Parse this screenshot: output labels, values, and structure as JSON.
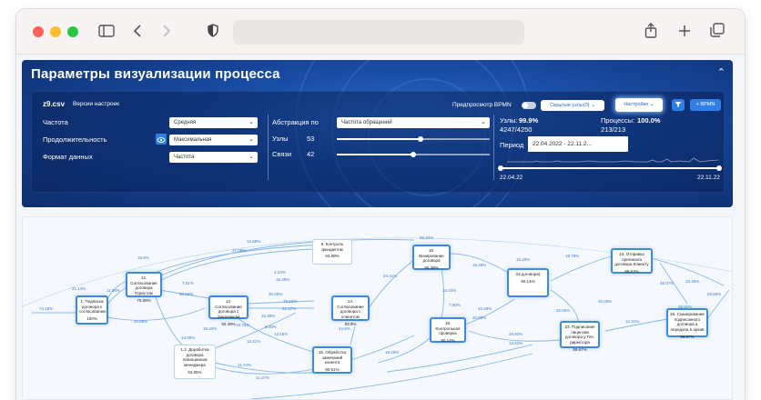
{
  "browser": {
    "icons": {
      "sidebar": "sidebar-icon",
      "back": "chevron-left-icon",
      "forward": "chevron-right-icon",
      "shield": "shield-icon",
      "share": "share-icon",
      "new_tab": "plus-icon",
      "tabs": "tabs-icon"
    }
  },
  "panel": {
    "title": "Параметры визуализации процесса",
    "file_name": "z9.csv",
    "settings_versions": "Версии настроек",
    "params": [
      {
        "label": "Частота",
        "value": "Средняя"
      },
      {
        "label": "Продолжительность",
        "value": "Максимальная"
      },
      {
        "label": "Формат данных",
        "value": "Частота"
      }
    ],
    "abstraction_label": "Абстракция по",
    "abstraction_value": "Частота обращений",
    "nodes_label": "Узлы",
    "nodes_value": "53",
    "nodes_level": 0.55,
    "links_label": "Связи",
    "links_value": "42",
    "links_level": 0.5,
    "bpmn_preview_label": "Предпросмотр BPMN",
    "hidden_nodes_button": "Скрытые узлы(0)",
    "settings_button": "Настройки",
    "bpmn_button": "BPMN",
    "stats": {
      "nodes_label": "Узлы:",
      "nodes_pct": "99.9%",
      "nodes_count": "4247/4250",
      "processes_label": "Процессы:",
      "processes_pct": "100.0%",
      "processes_count": "213/213"
    },
    "period_label": "Период",
    "period_value": "22.04.2022 - 22.11.2...",
    "date_start": "22.04.22",
    "date_end": "22.11.22",
    "accent": "#2f7fe6"
  },
  "graph": {
    "nodes": [
      {
        "id": "n1",
        "text": "1. Подписка договора к согласованию",
        "pct": "100%"
      },
      {
        "id": "n12",
        "text": "12. Согласование договора Юристом",
        "pct": "76.08%"
      },
      {
        "id": "n13",
        "text": "13. Согласование договора с Заказчиком",
        "pct": "92.49%"
      },
      {
        "id": "n12b",
        "text": "1.2. Доработка договора помощником менеджера",
        "pct": "53.95%"
      },
      {
        "id": "n9",
        "text": "9. Контроль финдиктом",
        "pct": "63.89%"
      },
      {
        "id": "n14",
        "text": "14. Согласование договора с клиентом",
        "pct": "93.9%"
      },
      {
        "id": "n15",
        "text": "15. Обработка замечаний клиента",
        "pct": "90.61%"
      },
      {
        "id": "n18",
        "text": "18. Визирование договора",
        "pct": "86.38%"
      },
      {
        "id": "n19",
        "text": "19. Контрольная проверка",
        "pct": "90.14%"
      },
      {
        "id": "n22",
        "text": "22 договора)",
        "pct": "90.14%"
      },
      {
        "id": "n23",
        "text": "23. Подписание лицензии договора у Ген. директора",
        "pct": "89.67%"
      },
      {
        "id": "n24",
        "text": "24. Отправка оригинала договора Клиенту",
        "pct": "89.67%"
      },
      {
        "id": "n26",
        "text": "26. Сканирование подписанного договора и передача в архив",
        "pct": "89.67%"
      }
    ],
    "edge_labels": [
      "74.18%",
      "21.13%",
      "11.98%",
      "16.9%",
      "35.68%",
      "7.51%",
      "50.56%",
      "37.09%",
      "12.68%",
      "4.23%",
      "15.49%",
      "30.05%",
      "76.53%",
      "22.47%",
      "32.39%",
      "9.39%",
      "13.15%",
      "12.21%",
      "18.75%",
      "14.08%",
      "16.43%",
      "11.74%",
      "11.27%",
      "19.25%",
      "44.6%",
      "56.34%",
      "24.41%",
      "16.43%",
      "15.49%",
      "7.98%",
      "42.49%",
      "40.85%",
      "25.82%",
      "13.62%",
      "15.49%",
      "32.86%",
      "18.78%",
      "30.05%",
      "45.07%",
      "12.21%",
      "36.62%",
      "15.49%",
      "20.65%"
    ]
  }
}
